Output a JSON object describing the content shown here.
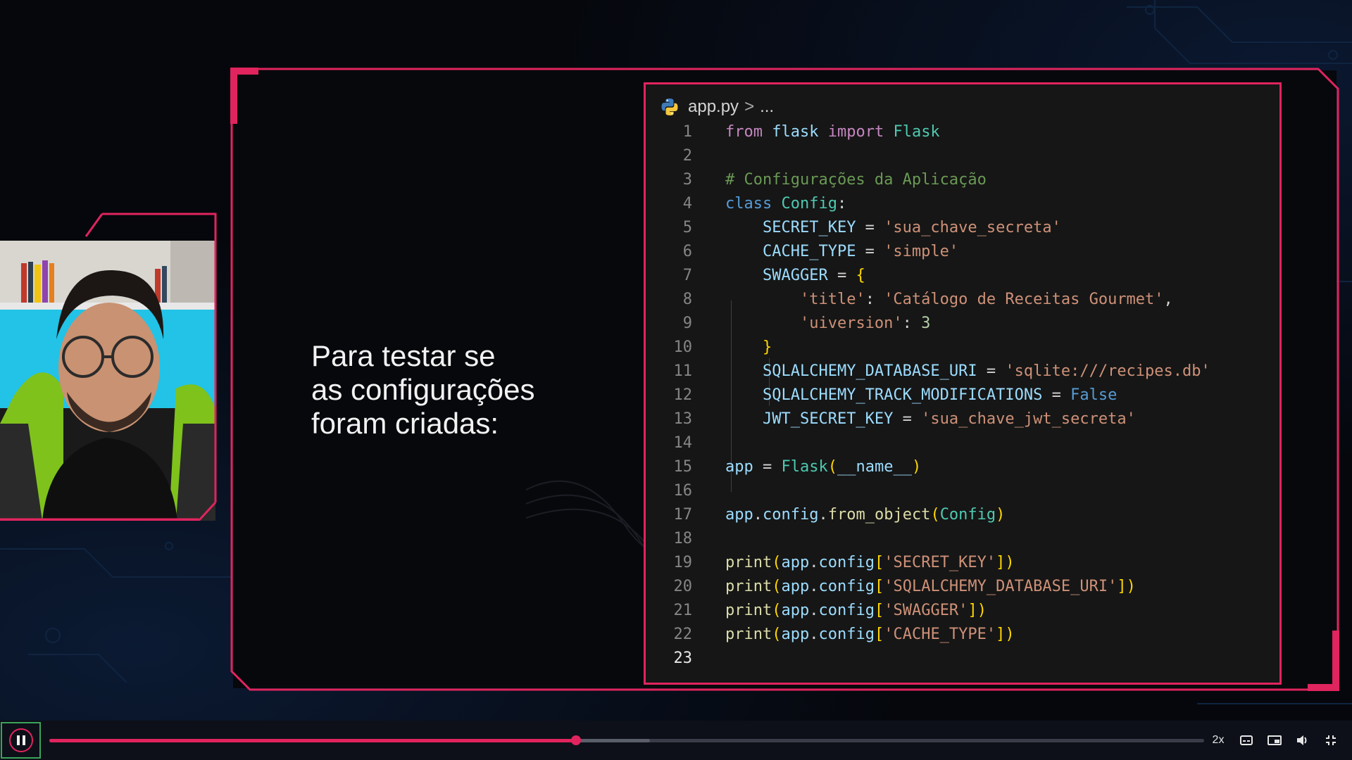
{
  "slide": {
    "text_lines": [
      "Para testar se",
      "as configurações",
      "foram criadas:"
    ]
  },
  "editor": {
    "filename": "app.py",
    "breadcrumb_sep": ">",
    "breadcrumb_more": "...",
    "active_line": 23,
    "lines": [
      "from flask import Flask",
      "",
      "# Configurações da Aplicação",
      "class Config:",
      "    SECRET_KEY = 'sua_chave_secreta'",
      "    CACHE_TYPE = 'simple'",
      "    SWAGGER = {",
      "        'title': 'Catálogo de Receitas Gourmet',",
      "        'uiversion': 3",
      "    }",
      "    SQLALCHEMY_DATABASE_URI = 'sqlite:///recipes.db'",
      "    SQLALCHEMY_TRACK_MODIFICATIONS = False",
      "    JWT_SECRET_KEY = 'sua_chave_jwt_secreta'",
      "",
      "app = Flask(__name__)",
      "",
      "app.config.from_object(Config)",
      "",
      "print(app.config['SECRET_KEY'])",
      "print(app.config['SQLALCHEMY_DATABASE_URI'])",
      "print(app.config['SWAGGER'])",
      "print(app.config['CACHE_TYPE'])",
      ""
    ]
  },
  "player": {
    "state": "playing",
    "progress_fraction": 0.456,
    "buffered_fraction": 0.52,
    "speed_label": "2x",
    "controls": [
      "subtitles-icon",
      "picture-in-picture-icon",
      "volume-icon",
      "exit-fullscreen-icon"
    ]
  },
  "colors": {
    "accent": "#e0245e",
    "play_outline": "#3aa35a",
    "background": "#05070c"
  }
}
